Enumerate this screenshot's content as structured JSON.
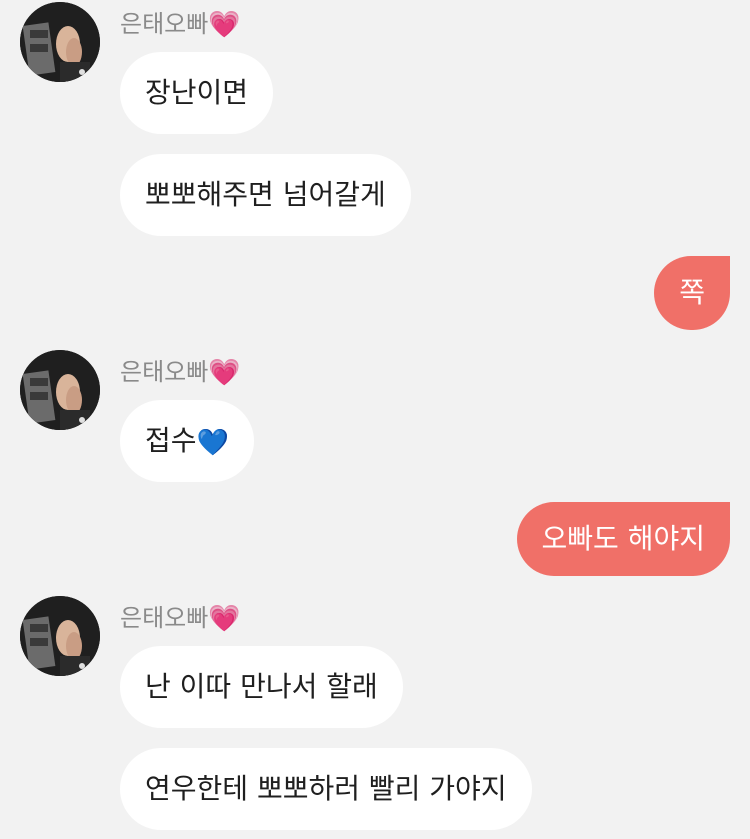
{
  "chat": {
    "contact_name": "은태오빠",
    "messages": [
      {
        "side": "incoming",
        "text": "장난이면"
      },
      {
        "side": "incoming",
        "text": "뽀뽀해주면 넘어갈게"
      },
      {
        "side": "outgoing",
        "text": "쪽"
      },
      {
        "side": "incoming",
        "text": "접수"
      },
      {
        "side": "outgoing",
        "text": "오빠도 해야지"
      },
      {
        "side": "incoming",
        "text": "난 이따 만나서 할래"
      },
      {
        "side": "incoming",
        "text": "연우한테 뽀뽀하러 빨리 가야지"
      }
    ]
  },
  "emojis": {
    "pink_heart": "💗",
    "blue_heart": "💙"
  },
  "colors": {
    "background": "#f2f2f2",
    "incoming_bubble": "#ffffff",
    "outgoing_bubble": "#f07068",
    "sender_name": "#8a8a8a"
  }
}
